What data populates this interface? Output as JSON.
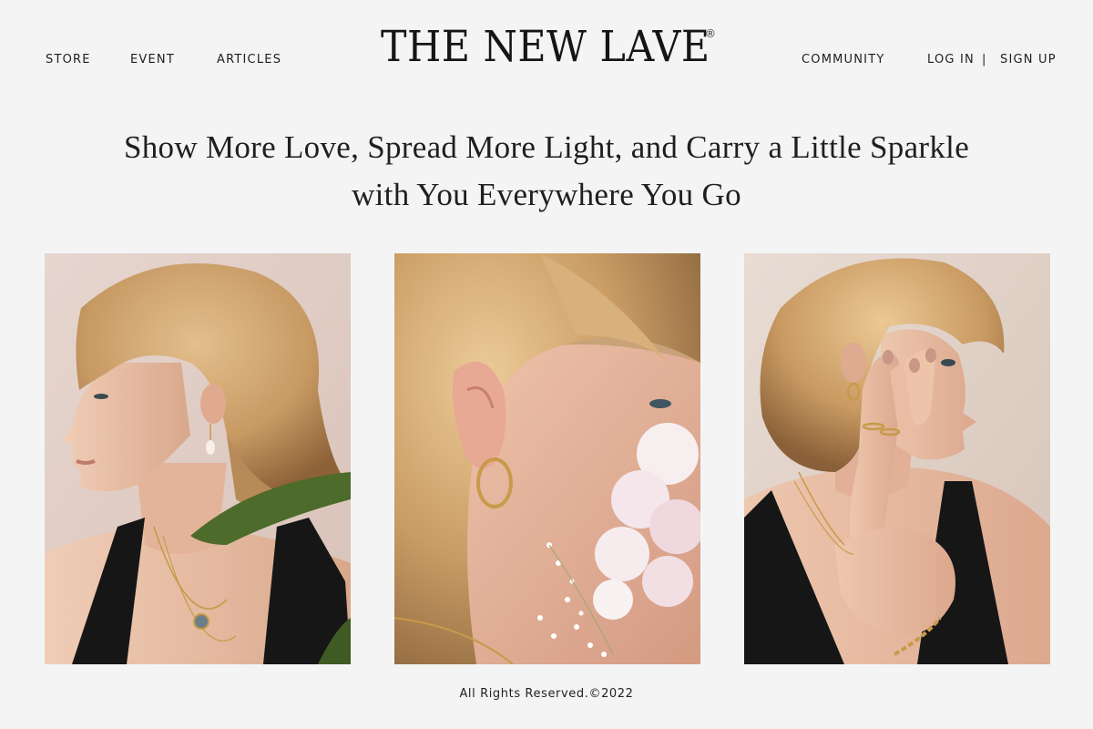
{
  "nav": {
    "left": {
      "store": "STORE",
      "event": "EVENT",
      "articles": "ARTICLES"
    },
    "right": {
      "community": "COMMUNITY",
      "login": "LOG IN",
      "separator": "|",
      "signup": "SIGN UP"
    }
  },
  "brand": {
    "name": "THE NEW LAVE",
    "registered_mark": "®"
  },
  "tagline": {
    "line1": "Show More Love, Spread More Light, and Carry a Little Sparkle",
    "line2": "with You Everywhere You Go"
  },
  "gallery": {
    "background_color": "#e8dcd6",
    "photos": [
      {
        "subject": "woman-profile-pendant-necklace"
      },
      {
        "subject": "ear-gold-hoop-earring-flowers"
      },
      {
        "subject": "woman-hand-rings-bracelet"
      }
    ]
  },
  "footer": {
    "copyright": "All Rights Reserved.©2022"
  },
  "colors": {
    "page_background": "#f4f4f4",
    "text": "#1f1f1f",
    "hair": "#c9a070",
    "skin": "#e8c0a8",
    "dress": "#1a1a1a",
    "gold": "#c89a4a",
    "leaf": "#4a6a2a"
  }
}
